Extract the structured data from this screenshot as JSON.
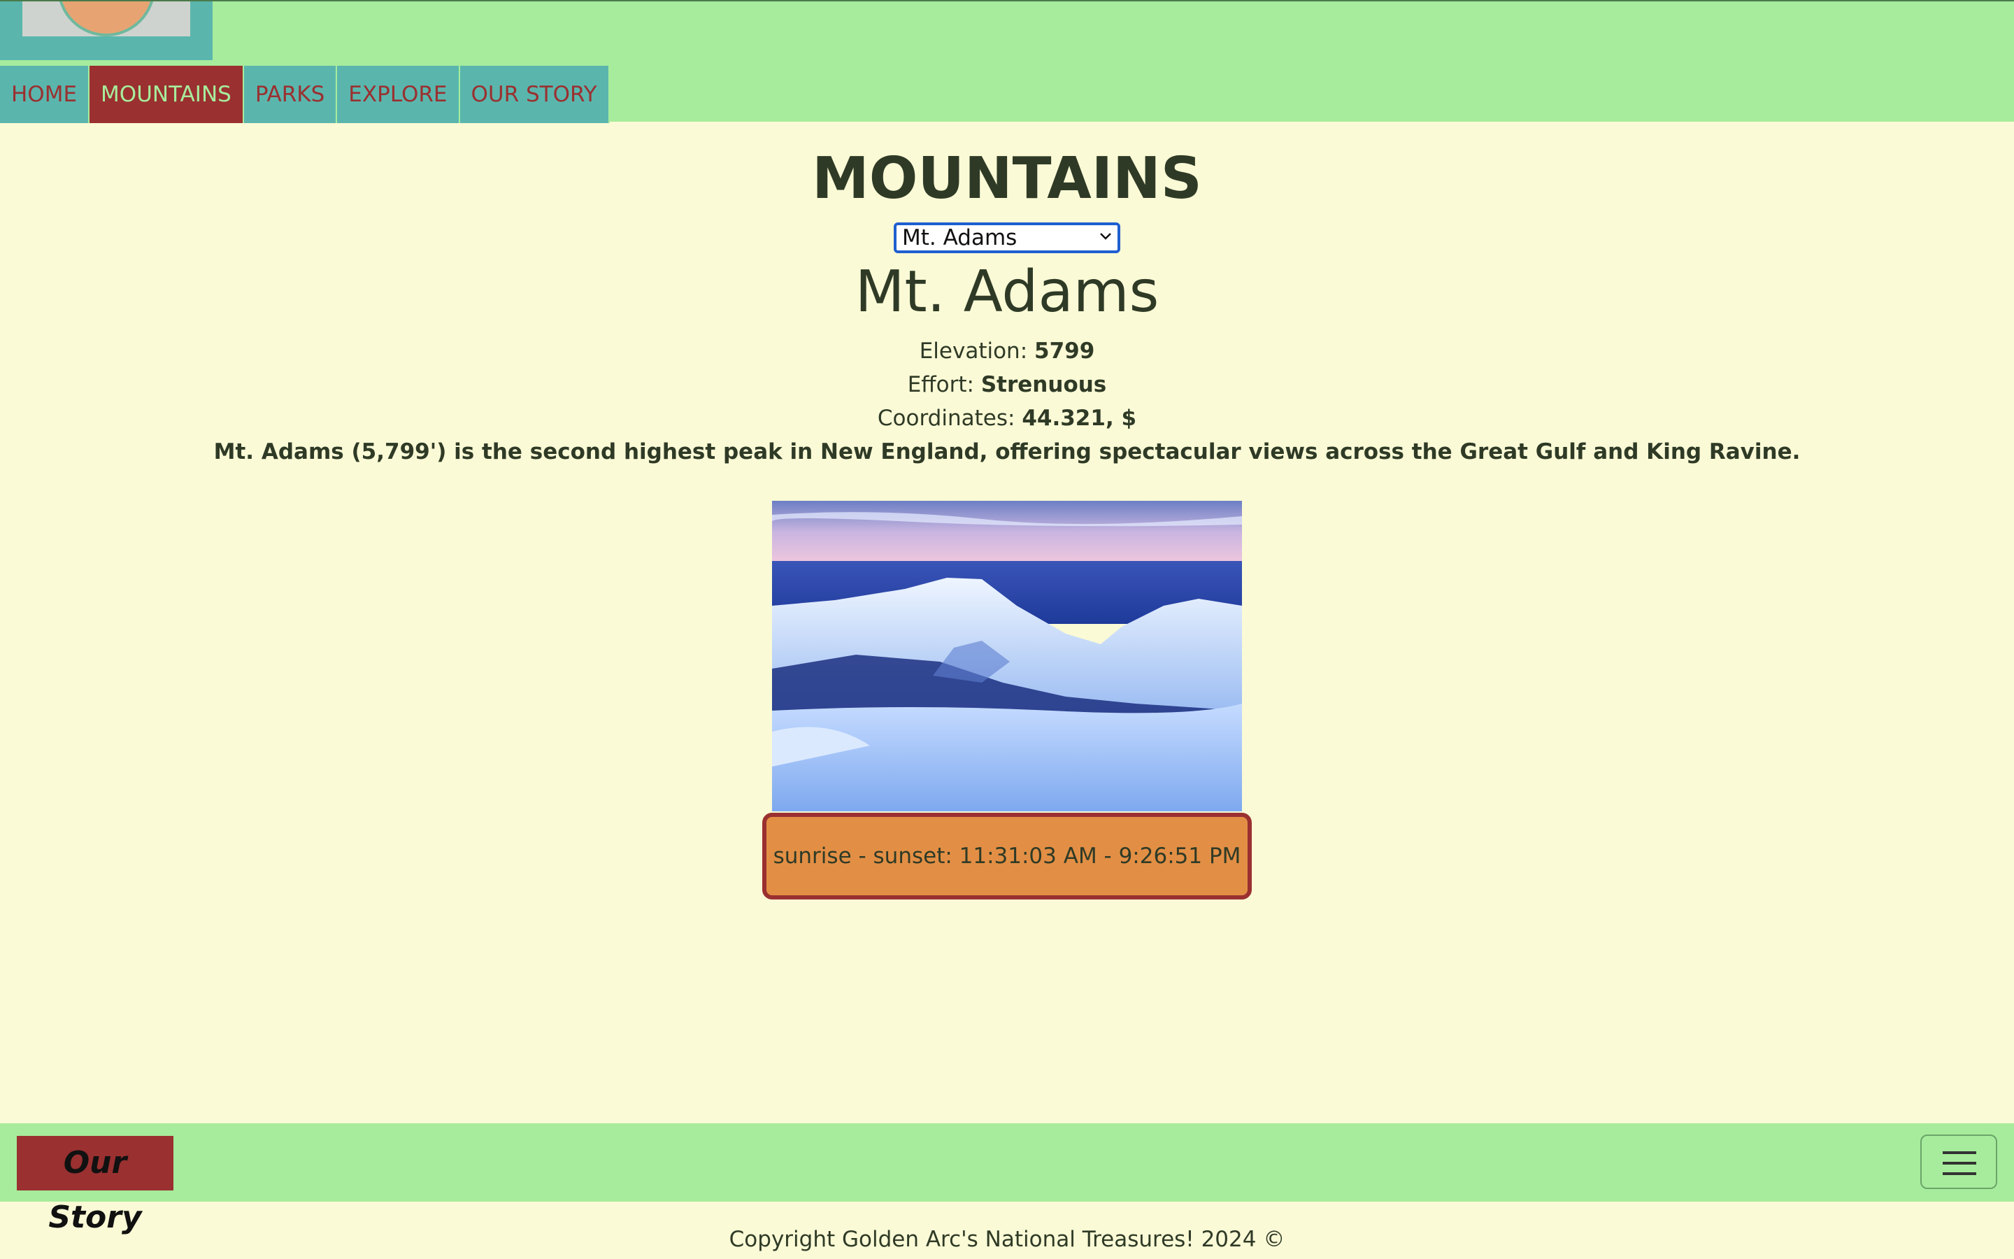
{
  "nav": {
    "items": [
      {
        "label": "HOME",
        "active": false
      },
      {
        "label": "MOUNTAINS",
        "active": true
      },
      {
        "label": "PARKS",
        "active": false
      },
      {
        "label": "EXPLORE",
        "active": false
      },
      {
        "label": "OUR STORY",
        "active": false
      }
    ]
  },
  "main": {
    "title": "MOUNTAINS",
    "select_value": "Mt. Adams",
    "mountain_name": "Mt. Adams",
    "elevation_label": "Elevation:",
    "elevation_value": "5799",
    "effort_label": "Effort:",
    "effort_value": "Strenuous",
    "coords_label": "Coordinates:",
    "coords_value": "44.321, $",
    "description": "Mt. Adams (5,799') is the second highest peak in New England, offering spectacular views across the Great Gulf and King Ravine.",
    "sun_times": "sunrise - sunset: 11:31:03 AM - 9:26:51 PM"
  },
  "footer": {
    "story_button": "Our Story",
    "copyright": "Copyright Golden Arc's National Treasures! 2024 ©"
  },
  "colors": {
    "header_bg": "#a7ec9c",
    "nav_bg": "#5ab6ad",
    "nav_active": "#9a3030",
    "page_bg": "#fafad6",
    "sun_box": "#e28f45"
  }
}
